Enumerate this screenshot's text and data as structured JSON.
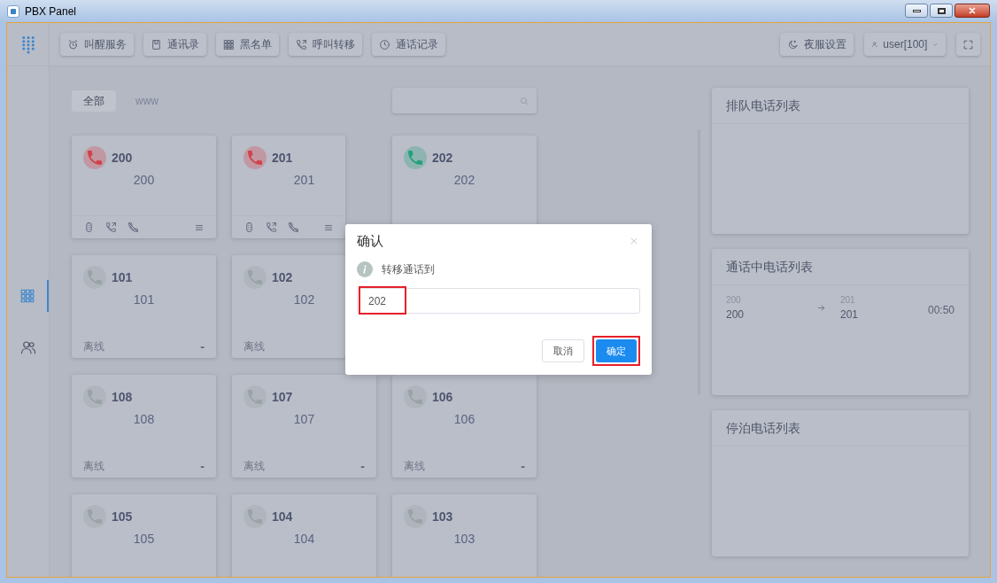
{
  "window": {
    "title": "PBX Panel"
  },
  "toolbar": {
    "buttons": [
      {
        "kind": "alarm",
        "label": "叫醒服务"
      },
      {
        "kind": "book",
        "label": "通讯录"
      },
      {
        "kind": "grid",
        "label": "黑名单"
      },
      {
        "kind": "forward",
        "label": "呼叫转移"
      },
      {
        "kind": "clock",
        "label": "通话记录"
      }
    ],
    "night_button": "夜服设置",
    "user_menu": "user[100]"
  },
  "sidebar": {
    "items": [
      {
        "kind": "grid",
        "selected": true
      },
      {
        "kind": "users",
        "selected": false
      }
    ]
  },
  "tabs": [
    {
      "label": "全部",
      "selected": true
    },
    {
      "label": "www",
      "selected": false
    }
  ],
  "extension_rows": [
    {
      "cards": [
        {
          "color": "#d0434c",
          "number": "200",
          "name": "200",
          "show_actions": true
        },
        {
          "color": "#d0434c",
          "number": "201",
          "name": "201",
          "show_actions": true
        },
        {
          "color": "#23a07c",
          "number": "202",
          "name": "202"
        }
      ]
    },
    {
      "cards": [
        {
          "color": "#98a3a6",
          "number": "101",
          "name": "101",
          "state": "离线",
          "dash": "-"
        },
        {
          "color": "#98a3a6",
          "number": "102",
          "name": "102",
          "state": "离线"
        }
      ]
    },
    {
      "cards": [
        {
          "color": "#98a3a6",
          "number": "108",
          "name": "108",
          "state": "离线",
          "dash": "-"
        },
        {
          "color": "#98a3a6",
          "number": "107",
          "name": "107",
          "state": "离线",
          "dash": "-"
        },
        {
          "color": "#98a3a6",
          "number": "106",
          "name": "106",
          "state": "离线",
          "dash": "-"
        }
      ]
    },
    {
      "cards": [
        {
          "color": "#98a3a6",
          "number": "105",
          "name": "105"
        },
        {
          "color": "#98a3a6",
          "number": "104",
          "name": "104"
        },
        {
          "color": "#98a3a6",
          "number": "103",
          "name": "103"
        }
      ]
    }
  ],
  "panels": [
    {
      "title": "排队电话列表"
    },
    {
      "title": "通话中电话列表",
      "calls": [
        {
          "from_label": "200",
          "from": "200",
          "to_label": "201",
          "to": "201",
          "duration": "00:50"
        }
      ]
    },
    {
      "title": "停泊电话列表"
    }
  ],
  "dialog": {
    "title": "确认",
    "message": "转移通话到",
    "value": "202",
    "buttons": [
      {
        "kind": "cancel",
        "label": "取消"
      },
      {
        "kind": "primary",
        "label": "确定"
      }
    ]
  }
}
